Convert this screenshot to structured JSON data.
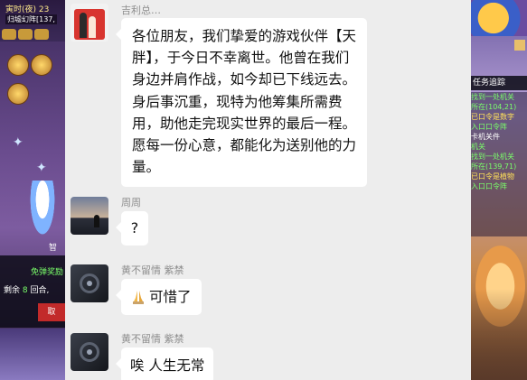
{
  "game_left": {
    "time_label": "寅时(夜)",
    "time_value": "23",
    "subtitle": "归墟幻阵[137,",
    "free_label": "免弹奖励",
    "remain_prefix": "剩余",
    "remain_count": "8",
    "remain_suffix": "回合,",
    "cancel_button": "取",
    "char_label": "智"
  },
  "game_right": {
    "task_label": "任务追踪",
    "task_lines": [
      {
        "text": "找到一处机关",
        "color": "g"
      },
      {
        "text": "所在(104,21)",
        "color": "g"
      },
      {
        "text": "已口令是数字",
        "color": "y"
      },
      {
        "text": "入口口令阵",
        "color": "g"
      },
      {
        "text": "卡机关件",
        "color": "w"
      },
      {
        "text": "机关",
        "color": "g"
      },
      {
        "text": "找到一处机关",
        "color": "g"
      },
      {
        "text": "所在(139,71)",
        "color": "g"
      },
      {
        "text": "已口令是植物",
        "color": "y"
      },
      {
        "text": "入口口令阵",
        "color": "g"
      }
    ]
  },
  "chat": {
    "messages": [
      {
        "sender": "吉利总…",
        "text": "各位朋友，我们挚爱的游戏伙伴【天胖】，于今日不幸离世。他曾在我们身边并肩作战，如今却已下线远去。身后事沉重，现特为他筹集所需费用，助他走完现实世界的最后一程。愿每一份心意，都能化为送别他的力量。",
        "avatar": "couple-photo-avatar"
      },
      {
        "sender": "周周",
        "text": "?",
        "avatar": "landscape-avatar"
      },
      {
        "sender": "黄不留情  紫禁",
        "text": "可惜了",
        "emoji": "pray",
        "avatar": "camera-avatar"
      },
      {
        "sender": "黄不留情  紫禁",
        "text": "唉 人生无常",
        "avatar": "camera-avatar"
      }
    ]
  },
  "colors": {
    "chat_bg": "#ededed",
    "bubble_bg": "#ffffff",
    "sender_name": "#8d8d8d",
    "game_green": "#7aff6a",
    "game_yellow": "#ffe15a"
  }
}
